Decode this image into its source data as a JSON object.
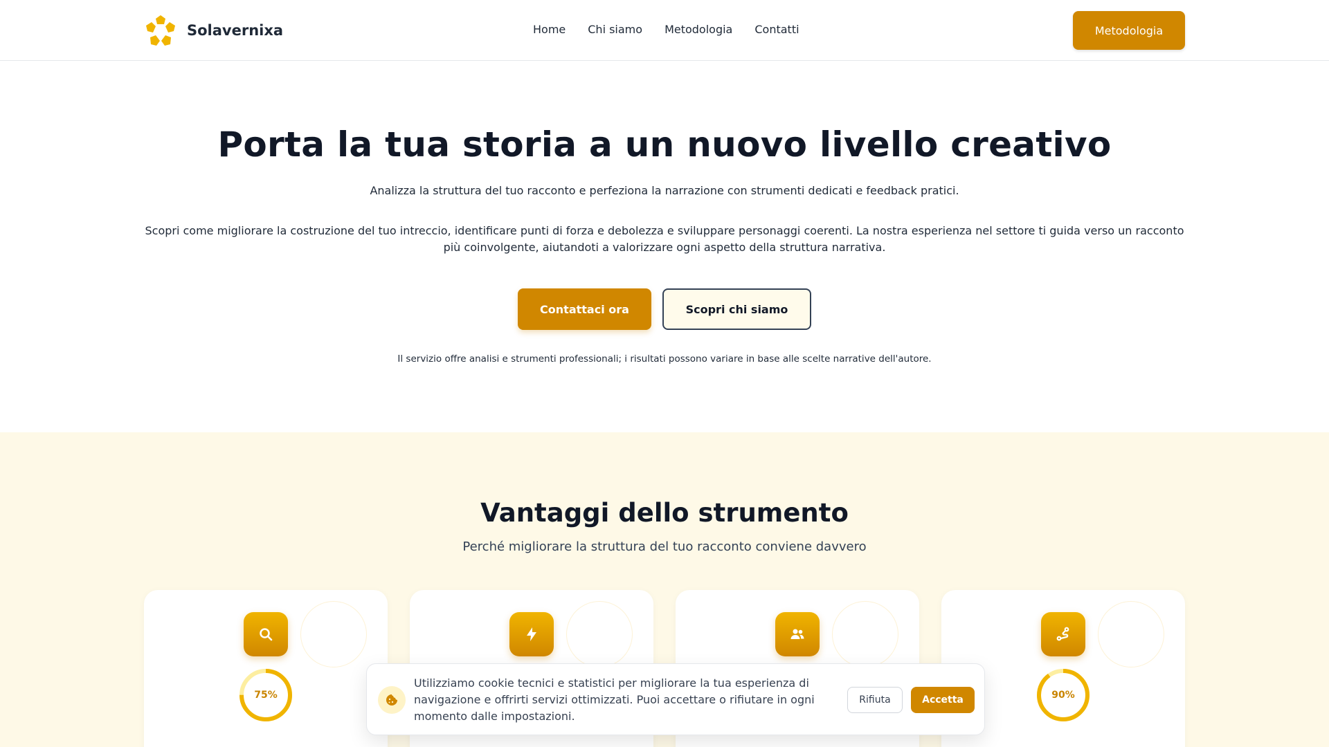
{
  "header": {
    "brand_name": "Solavernixa",
    "logo_icon": "flower-pentagon-icon",
    "nav": [
      {
        "label": "Home"
      },
      {
        "label": "Chi siamo"
      },
      {
        "label": "Metodologia"
      },
      {
        "label": "Contatti"
      }
    ],
    "cta_label": "Metodologia"
  },
  "hero": {
    "title": "Porta la tua storia a un nuovo livello creativo",
    "lead": "Analizza la struttura del tuo racconto e perfeziona la narrazione con strumenti dedicati e feedback pratici.",
    "body": "Scopri come migliorare la costruzione del tuo intreccio, identificare punti di forza e debolezza e sviluppare personaggi coerenti. La nostra esperienza nel settore ti guida verso un racconto più coinvolgente, aiutandoti a valorizzare ogni aspetto della struttura narrativa.",
    "primary_button": "Contattaci ora",
    "secondary_button": "Scopri chi siamo",
    "note": "Il servizio offre analisi e strumenti professionali; i risultati possono variare in base alle scelte narrative dell'autore."
  },
  "benefits": {
    "title": "Vantaggi dello strumento",
    "subtitle": "Perché migliorare la struttura del tuo racconto conviene davvero",
    "cards": [
      {
        "icon": "search-icon",
        "percent": 75,
        "percent_label": "75%"
      },
      {
        "icon": "lightning-icon",
        "percent": null,
        "percent_label": ""
      },
      {
        "icon": "users-icon",
        "percent": null,
        "percent_label": ""
      },
      {
        "icon": "route-icon",
        "percent": 90,
        "percent_label": "90%"
      }
    ]
  },
  "cookie_banner": {
    "icon": "cookie-icon",
    "text": "Utilizziamo cookie tecnici e statistici per migliorare la tua esperienza di navigazione e offrirti servizi ottimizzati. Puoi accettare o rifiutare in ogni momento dalle impostazioni.",
    "reject_label": "Rifiuta",
    "accept_label": "Accetta"
  },
  "colors": {
    "accent": "#d08700",
    "accent_light": "#f0b400",
    "section_bg": "#fef9e7",
    "text_dark": "#111827"
  }
}
